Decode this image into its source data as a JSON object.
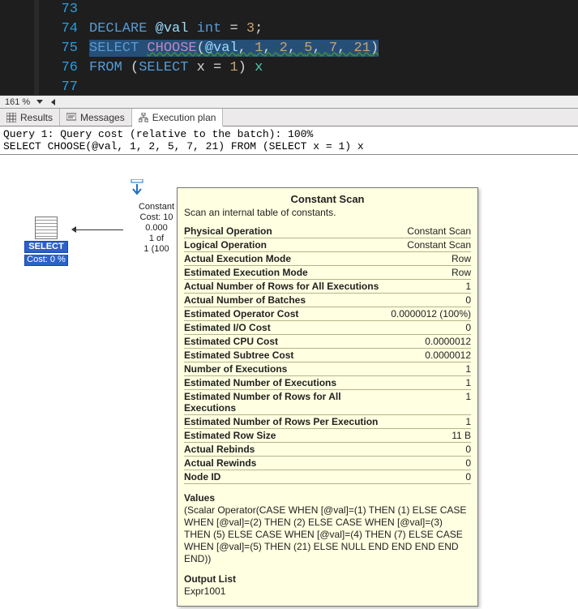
{
  "editor": {
    "lines": [
      {
        "num": "73",
        "html": ""
      },
      {
        "num": "74",
        "html": "<span class='kw'>DECLARE</span> <span class='var'>@val</span> <span class='kw'>int</span> = <span class='num'>3</span>;"
      },
      {
        "num": "75",
        "html": "<span class='sel'><span class='kw'>SELECT</span> <span class='fn wavy'>CHOOSE</span><span class='wavy'>(<span class='var'>@val</span>, <span class='num'>1</span>, <span class='num'>2</span>, <span class='num'>5</span>, <span class='num'>7</span>, <span class='num'>21</span>)</span></span>"
      },
      {
        "num": "76",
        "html": "<span class='kw'>FROM</span> (<span class='kw'>SELECT</span> x = <span class='num'>1</span>) <span class='alias'>x</span>"
      },
      {
        "num": "77",
        "html": ""
      }
    ]
  },
  "zoom": "161 %",
  "tabs": {
    "results": "Results",
    "messages": "Messages",
    "plan": "Execution plan"
  },
  "query": {
    "header": "Query 1: Query cost (relative to the batch): 100%",
    "sql": "SELECT CHOOSE(@val, 1, 2, 5, 7, 21) FROM (SELECT x = 1) x"
  },
  "plan": {
    "select": {
      "label": "SELECT",
      "cost": "Cost: 0 %"
    },
    "scan": {
      "l1": "Constant",
      "l2": "Cost: 10",
      "l3": "0.000",
      "l4": "1 of",
      "l5": "1 (100"
    }
  },
  "tooltip": {
    "title": "Constant Scan",
    "desc": "Scan an internal table of constants.",
    "rows": [
      {
        "k": "Physical Operation",
        "v": "Constant Scan"
      },
      {
        "k": "Logical Operation",
        "v": "Constant Scan"
      },
      {
        "k": "Actual Execution Mode",
        "v": "Row"
      },
      {
        "k": "Estimated Execution Mode",
        "v": "Row"
      },
      {
        "k": "Actual Number of Rows for All Executions",
        "v": "1"
      },
      {
        "k": "Actual Number of Batches",
        "v": "0"
      },
      {
        "k": "Estimated Operator Cost",
        "v": "0.0000012 (100%)"
      },
      {
        "k": "Estimated I/O Cost",
        "v": "0"
      },
      {
        "k": "Estimated CPU Cost",
        "v": "0.0000012"
      },
      {
        "k": "Estimated Subtree Cost",
        "v": "0.0000012"
      },
      {
        "k": "Number of Executions",
        "v": "1"
      },
      {
        "k": "Estimated Number of Executions",
        "v": "1"
      },
      {
        "k": "Estimated Number of Rows for All Executions",
        "v": "1"
      },
      {
        "k": "Estimated Number of Rows Per Execution",
        "v": "1"
      },
      {
        "k": "Estimated Row Size",
        "v": "11 B"
      },
      {
        "k": "Actual Rebinds",
        "v": "0"
      },
      {
        "k": "Actual Rewinds",
        "v": "0"
      },
      {
        "k": "Node ID",
        "v": "0"
      }
    ],
    "values_h": "Values",
    "values": "(Scalar Operator(CASE WHEN [@val]=(1) THEN (1) ELSE CASE WHEN [@val]=(2) THEN (2) ELSE CASE WHEN [@val]=(3) THEN (5) ELSE CASE WHEN [@val]=(4) THEN (7) ELSE CASE WHEN [@val]=(5) THEN (21) ELSE NULL END END END END END))",
    "output_h": "Output List",
    "output": "Expr1001"
  }
}
